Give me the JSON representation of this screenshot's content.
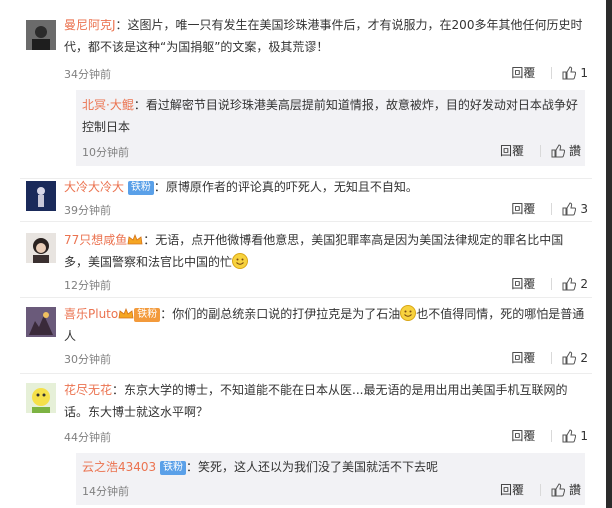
{
  "comments": [
    {
      "user": "曼尼阿克J",
      "text_line1": "：这图片，唯一只有发生在美国珍珠港事件后，才有说服力，在200多年其他任何历史时",
      "text_line2": "代，都不该是这种“为国捐躯”的文案，极其荒谬！",
      "time": "34分钟前",
      "reply_label": "回覆",
      "likes": "1",
      "subreply": {
        "user": "北冥·大鲲",
        "text_line1": "：看过解密节目说珍珠港美高层提前知道情报，故意被炸，目的好发动对日本战争好",
        "text_line2": "控制日本",
        "time": "10分钟前",
        "reply_label": "回覆",
        "like_label": "讚"
      }
    },
    {
      "user": "大冷大冷大",
      "badge": "铁粉",
      "text": "：原博原作者的评论真的吓死人，无知且不自知。",
      "time": "39分钟前",
      "reply_label": "回覆",
      "likes": "3"
    },
    {
      "user": "77只想咸鱼",
      "text_line1": "：无语，点开他微博看他意思，美国犯罪率高是因为美国法律规定的罪名比中国",
      "text_line2": "多，美国警察和法官比中国的忙",
      "time": "12分钟前",
      "reply_label": "回覆",
      "likes": "2"
    },
    {
      "user": "喜乐Pluto",
      "badge": "铁粉",
      "text_line1": "：你们的副总统亲口说的打伊拉克是为了石油",
      "text_line1b": "也不值得同情，死的哪怕是普通",
      "text_line2": "人",
      "time": "30分钟前",
      "reply_label": "回覆",
      "likes": "2"
    },
    {
      "user": "花尽无花",
      "text_line1": "：东京大学的博士，不知道能不能在日本从医...最无语的是用出用出美国手机互联网的",
      "text_line2": "话。东大博士就这水平啊？",
      "time": "44分钟前",
      "reply_label": "回覆",
      "likes": "1",
      "subreply": {
        "user": "云之浩43403",
        "badge": "铁粉",
        "text": "：笑死，这人还以为我们没了美国就活不下去呢",
        "time": "14分钟前",
        "reply_label": "回覆",
        "like_label": "讚"
      }
    }
  ],
  "colors": {
    "username": "#eb7350",
    "text": "#333333",
    "muted": "#808080",
    "subreply_bg": "#f2f2f5",
    "badge": "#5aa0e8"
  },
  "icons": [
    "thumbs-up-icon",
    "smile-emoji-icon",
    "crown-icon"
  ]
}
